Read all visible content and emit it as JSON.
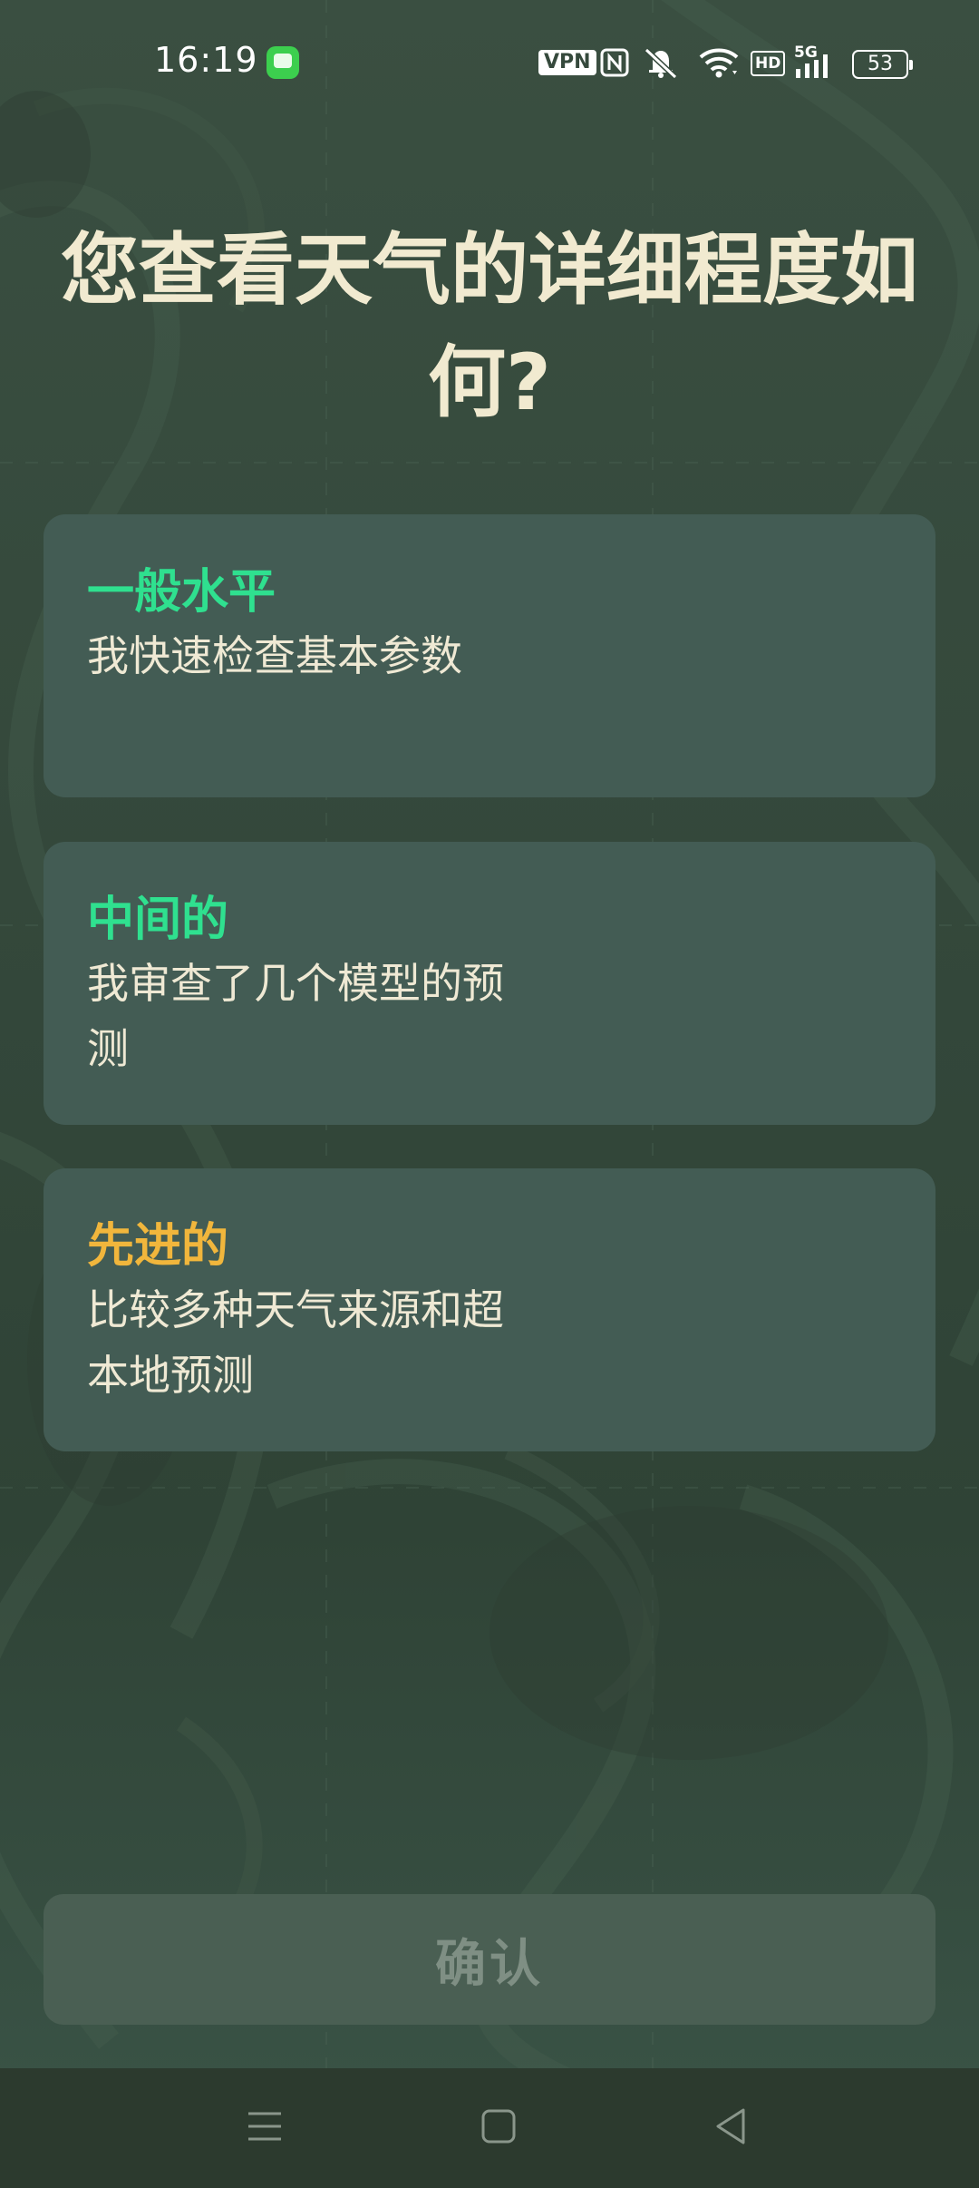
{
  "status_bar": {
    "time": "16:19",
    "vpn_label": "VPN",
    "hd_label": "HD",
    "network_label": "5G",
    "battery_level": "53",
    "icons": [
      "messages-app-icon",
      "vpn-icon",
      "nfc-icon",
      "mute-bell-icon",
      "wifi-icon",
      "hd-icon",
      "5g-signal-icon",
      "battery-icon"
    ]
  },
  "page": {
    "title": "您查看天气的详细程度如何?"
  },
  "options": [
    {
      "title": "一般水平",
      "description": "我快速检查基本参数",
      "title_color": "#2fe08f"
    },
    {
      "title": "中间的",
      "description": "我审查了几个模型的预测",
      "title_color": "#2fe08f"
    },
    {
      "title": "先进的",
      "description": "比较多种天气来源和超本地预测",
      "title_color": "#f1b63c"
    }
  ],
  "confirm_button": {
    "label": "确认"
  },
  "nav_bar": {
    "icons": [
      "menu-icon",
      "home-icon",
      "back-icon"
    ]
  },
  "colors": {
    "background": "#35493c",
    "card": "#435c54",
    "accent_green": "#2fe08f",
    "accent_orange": "#f1b63c",
    "title_text": "#f1ead0",
    "button_disabled": "#4a5f53"
  }
}
